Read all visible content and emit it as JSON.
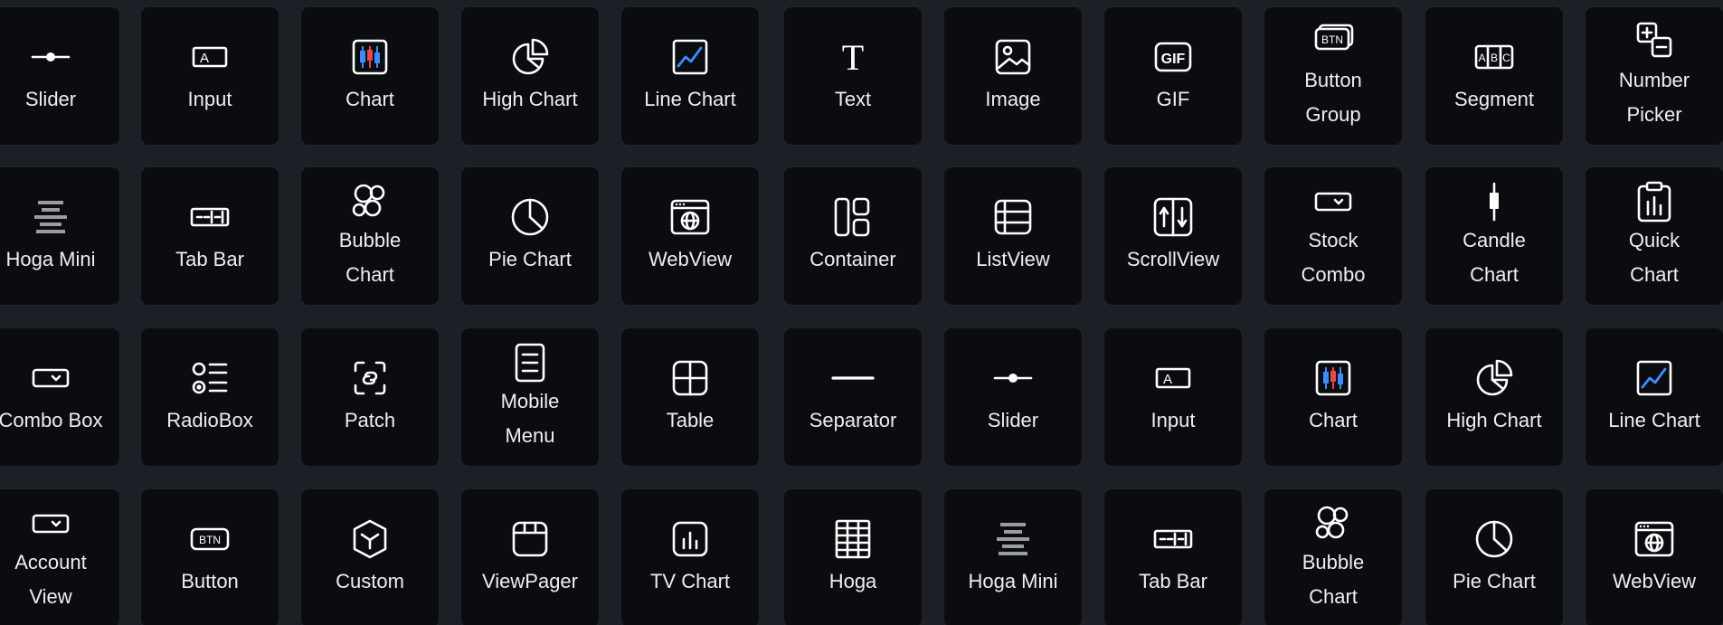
{
  "palette": {
    "background": "#1d1f27",
    "tile": "#0b0c10",
    "icon_stroke": "#ffffff",
    "accent_red": "#e5484d",
    "accent_blue": "#3d8bfd"
  },
  "rows": [
    [
      {
        "label": "Slider",
        "icon": "slider-icon"
      },
      {
        "label": "Input",
        "icon": "input-icon"
      },
      {
        "label": "Chart",
        "icon": "candlestick-chart-icon"
      },
      {
        "label": "High Chart",
        "icon": "high-chart-icon"
      },
      {
        "label": "Line Chart",
        "icon": "line-chart-icon"
      },
      {
        "label": "Text",
        "icon": "text-icon"
      },
      {
        "label": "Image",
        "icon": "image-icon"
      },
      {
        "label": "GIF",
        "icon": "gif-icon"
      },
      {
        "label": "Button\nGroup",
        "icon": "button-group-icon"
      },
      {
        "label": "Segment",
        "icon": "segment-icon"
      },
      {
        "label": "Number\nPicker",
        "icon": "number-picker-icon"
      }
    ],
    [
      {
        "label": "Hoga Mini",
        "icon": "hoga-mini-icon"
      },
      {
        "label": "Tab Bar",
        "icon": "tab-bar-icon"
      },
      {
        "label": "Bubble\nChart",
        "icon": "bubble-chart-icon"
      },
      {
        "label": "Pie Chart",
        "icon": "pie-chart-icon"
      },
      {
        "label": "WebView",
        "icon": "webview-icon"
      },
      {
        "label": "Container",
        "icon": "container-icon"
      },
      {
        "label": "ListView",
        "icon": "listview-icon"
      },
      {
        "label": "ScrollView",
        "icon": "scrollview-icon"
      },
      {
        "label": "Stock\nCombo",
        "icon": "combo-icon"
      },
      {
        "label": "Candle\nChart",
        "icon": "candle-icon"
      },
      {
        "label": "Quick\nChart",
        "icon": "quick-chart-icon"
      }
    ],
    [
      {
        "label": "Combo Box",
        "icon": "combo-icon"
      },
      {
        "label": "RadioBox",
        "icon": "radiobox-icon"
      },
      {
        "label": "Patch",
        "icon": "patch-icon"
      },
      {
        "label": "Mobile\nMenu",
        "icon": "mobile-menu-icon"
      },
      {
        "label": "Table",
        "icon": "table-icon"
      },
      {
        "label": "Separator",
        "icon": "separator-icon"
      },
      {
        "label": "Slider",
        "icon": "slider-icon"
      },
      {
        "label": "Input",
        "icon": "input-icon"
      },
      {
        "label": "Chart",
        "icon": "candlestick-chart-icon"
      },
      {
        "label": "High Chart",
        "icon": "high-chart-icon"
      },
      {
        "label": "Line Chart",
        "icon": "line-chart-icon"
      }
    ],
    [
      {
        "label": "Account\nView",
        "icon": "combo-icon"
      },
      {
        "label": "Button",
        "icon": "button-icon"
      },
      {
        "label": "Custom",
        "icon": "custom-cube-icon"
      },
      {
        "label": "ViewPager",
        "icon": "viewpager-icon"
      },
      {
        "label": "TV Chart",
        "icon": "tv-chart-icon"
      },
      {
        "label": "Hoga",
        "icon": "hoga-icon"
      },
      {
        "label": "Hoga Mini",
        "icon": "hoga-mini-icon"
      },
      {
        "label": "Tab Bar",
        "icon": "tab-bar-icon"
      },
      {
        "label": "Bubble\nChart",
        "icon": "bubble-chart-icon"
      },
      {
        "label": "Pie Chart",
        "icon": "pie-chart-icon"
      },
      {
        "label": "WebView",
        "icon": "webview-icon"
      }
    ]
  ]
}
